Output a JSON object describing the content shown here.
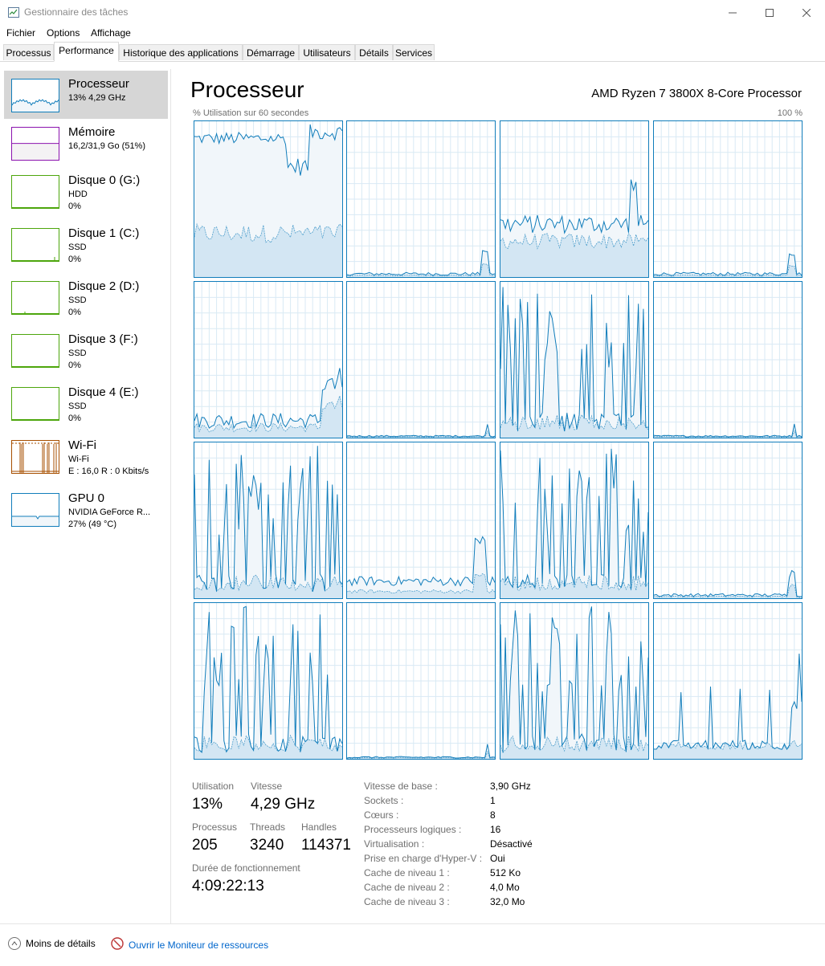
{
  "window": {
    "title": "Gestionnaire des tâches",
    "minimize_icon": "minimize-icon",
    "maximize_icon": "maximize-icon",
    "close_icon": "close-icon"
  },
  "menu": [
    "Fichier",
    "Options",
    "Affichage"
  ],
  "tabs": [
    "Processus",
    "Performance",
    "Historique des applications",
    "Démarrage",
    "Utilisateurs",
    "Détails",
    "Services"
  ],
  "active_tab": "Performance",
  "sidebar": {
    "items": [
      {
        "name": "Processeur",
        "sub1": "13% 4,29 GHz",
        "sub2": "",
        "color": "#117dbb",
        "fill": "#f1f6fa",
        "selected": true
      },
      {
        "name": "Mémoire",
        "sub1": "16,2/31,9 Go (51%)",
        "sub2": "",
        "color": "#8b12ae",
        "fill": "#f4f2f4",
        "selected": false
      },
      {
        "name": "Disque 0 (G:)",
        "sub1": "HDD",
        "sub2": "0%",
        "color": "#4da60c",
        "fill": "#ffffff",
        "selected": false
      },
      {
        "name": "Disque 1 (C:)",
        "sub1": "SSD",
        "sub2": "0%",
        "color": "#4da60c",
        "fill": "#ffffff",
        "selected": false
      },
      {
        "name": "Disque 2 (D:)",
        "sub1": "SSD",
        "sub2": "0%",
        "color": "#4da60c",
        "fill": "#ffffff",
        "selected": false
      },
      {
        "name": "Disque 3 (F:)",
        "sub1": "SSD",
        "sub2": "0%",
        "color": "#4da60c",
        "fill": "#ffffff",
        "selected": false
      },
      {
        "name": "Disque 4 (E:)",
        "sub1": "SSD",
        "sub2": "0%",
        "color": "#4da60c",
        "fill": "#ffffff",
        "selected": false
      },
      {
        "name": "Wi-Fi",
        "sub1": "Wi-Fi",
        "sub2": "E : 16,0 R : 0 Kbits/s",
        "color": "#a74f01",
        "fill": "#ffffff",
        "selected": false
      },
      {
        "name": "GPU 0",
        "sub1": "NVIDIA GeForce R...",
        "sub2": "27% (49 °C)",
        "color": "#117dbb",
        "fill": "#f1f6fa",
        "selected": false
      }
    ]
  },
  "main": {
    "title": "Processeur",
    "cpu_model": "AMD Ryzen 7 3800X 8-Core Processor",
    "axis_label": "% Utilisation sur 60 secondes",
    "axis_max": "100 %",
    "line_color": "#117dbb",
    "fill_color": "#f1f6fa",
    "grid_color": "#d9eaf4",
    "stats": {
      "utilisation_label": "Utilisation",
      "utilisation_value": "13%",
      "vitesse_label": "Vitesse",
      "vitesse_value": "4,29 GHz",
      "processus_label": "Processus",
      "processus_value": "205",
      "threads_label": "Threads",
      "threads_value": "3240",
      "handles_label": "Handles",
      "handles_value": "114371",
      "uptime_label": "Durée de fonctionnement",
      "uptime_value": "4:09:22:13"
    },
    "specs": [
      {
        "label": "Vitesse de base :",
        "value": "3,90 GHz"
      },
      {
        "label": "Sockets :",
        "value": "1"
      },
      {
        "label": "Cœurs :",
        "value": "8"
      },
      {
        "label": "Processeurs logiques :",
        "value": "16"
      },
      {
        "label": "Virtualisation :",
        "value": "Désactivé"
      },
      {
        "label": "Prise en charge d'Hyper-V :",
        "value": "Oui"
      },
      {
        "label": "Cache de niveau 1 :",
        "value": "512 Ko"
      },
      {
        "label": "Cache de niveau 2 :",
        "value": "4,0 Mo"
      },
      {
        "label": "Cache de niveau 3 :",
        "value": "32,0 Mo"
      }
    ]
  },
  "footer": {
    "less_details": "Moins de détails",
    "resource_monitor": "Ouvrir le Moniteur de ressources"
  },
  "chart_data": {
    "type": "line",
    "title": "",
    "xlabel": "% Utilisation sur 60 secondes",
    "ylabel": "",
    "ylim": [
      0,
      100
    ],
    "grid": true,
    "series": [
      {
        "profile": "high"
      },
      {
        "profile": "idle-spike"
      },
      {
        "profile": "mid"
      },
      {
        "profile": "idle-spike"
      },
      {
        "profile": "low-bump"
      },
      {
        "profile": "idle"
      },
      {
        "profile": "spiky"
      },
      {
        "profile": "idle"
      },
      {
        "profile": "spiky"
      },
      {
        "profile": "low-spike"
      },
      {
        "profile": "spiky"
      },
      {
        "profile": "idle-spike"
      },
      {
        "profile": "spiky"
      },
      {
        "profile": "idle"
      },
      {
        "profile": "spiky"
      },
      {
        "profile": "sparse"
      }
    ]
  }
}
